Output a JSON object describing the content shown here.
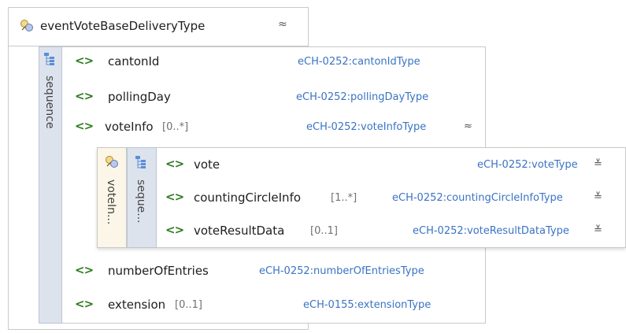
{
  "outer": {
    "title": "eventVoteBaseDeliveryType",
    "collapse_glyph": "≈",
    "sequence_label": "sequence"
  },
  "elements": [
    {
      "name": "cantonId",
      "card": "",
      "type": "eCH-0252:cantonIdType"
    },
    {
      "name": "pollingDay",
      "card": "",
      "type": "eCH-0252:pollingDayType"
    },
    {
      "name": "voteInfo",
      "card": "[0..*]",
      "type": "eCH-0252:voteInfoType",
      "expander": "≈"
    },
    {
      "name": "numberOfEntries",
      "card": "",
      "type": "eCH-0252:numberOfEntriesType"
    },
    {
      "name": "extension",
      "card": "[0..1]",
      "type": "eCH-0155:extensionType"
    }
  ],
  "voteInfo_box": {
    "label": "voteIn...",
    "sequence_label": "seque...",
    "items": [
      {
        "name": "vote",
        "card": "",
        "type": "eCH-0252:voteType",
        "expander": "≚"
      },
      {
        "name": "countingCircleInfo",
        "card": "[1..*]",
        "type": "eCH-0252:countingCircleInfoType",
        "expander": "≚"
      },
      {
        "name": "voteResultData",
        "card": "[0..1]",
        "type": "eCH-0252:voteResultDataType",
        "expander": "≚"
      }
    ]
  },
  "icons": {
    "element": "<>",
    "complex_type": "complex-type-icon",
    "sequence": "sequence-icon"
  },
  "colors": {
    "element_icon": "#2d7a1e",
    "type_text": "#3a73c4",
    "sequence_strip": "#dde3ed",
    "complex_strip": "#fbf6e7"
  }
}
